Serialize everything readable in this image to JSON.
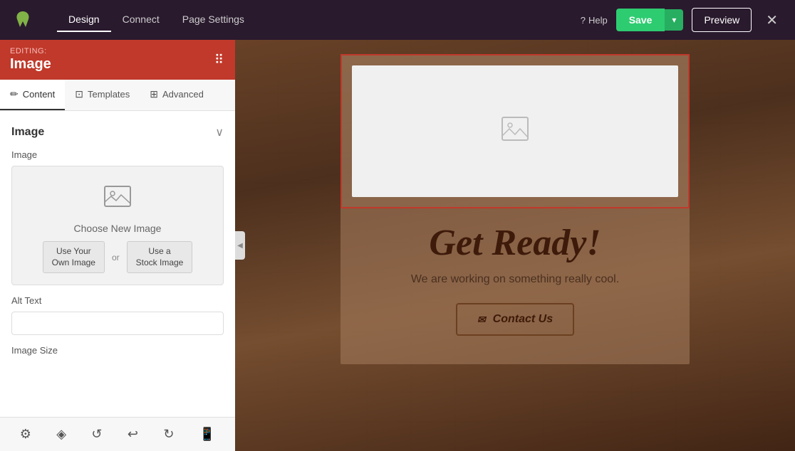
{
  "topbar": {
    "logo_alt": "Wix Logo",
    "nav": [
      {
        "label": "Design",
        "active": true
      },
      {
        "label": "Connect",
        "active": false
      },
      {
        "label": "Page Settings",
        "active": false
      }
    ],
    "help_label": "Help",
    "save_label": "Save",
    "preview_label": "Preview",
    "close_icon": "✕"
  },
  "editing_header": {
    "editing_label": "EDITING:",
    "title": "Image",
    "dots_icon": "⠿"
  },
  "panel_tabs": [
    {
      "label": "Content",
      "icon": "✏️",
      "active": true
    },
    {
      "label": "Templates",
      "icon": "⊡",
      "active": false
    },
    {
      "label": "Advanced",
      "icon": "⊞",
      "active": false
    }
  ],
  "panel": {
    "section_title": "Image",
    "chevron": "∨",
    "image_label": "Image",
    "choose_new_image": "Choose New Image",
    "use_own_image": "Use Your\nOwn Image",
    "or_label": "or",
    "use_stock_image": "Use a\nStock Image",
    "alt_text_label": "Alt Text",
    "alt_text_placeholder": "",
    "image_size_label": "Image Size"
  },
  "toolbar": {
    "settings_icon": "⚙",
    "layers_icon": "◈",
    "history_icon": "↺",
    "undo_icon": "↩",
    "redo_icon": "↻",
    "mobile_icon": "📱"
  },
  "canvas": {
    "heading": "Get Ready!",
    "subtext": "We are working on something really cool.",
    "contact_button": "Contact Us",
    "contact_icon": "✉"
  }
}
